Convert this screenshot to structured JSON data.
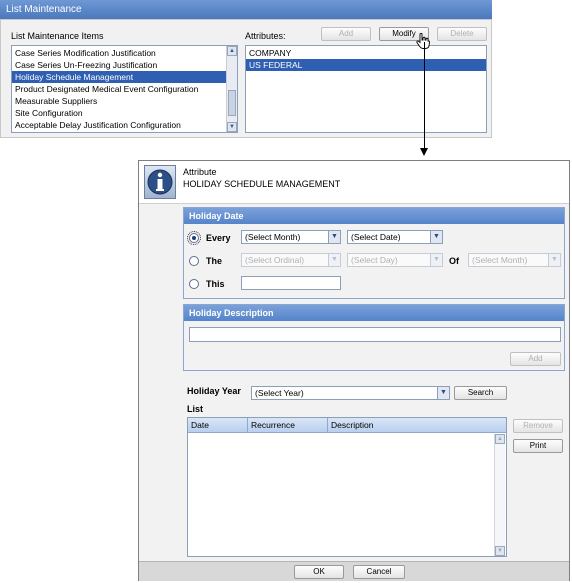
{
  "list_maintenance": {
    "title": "List Maintenance",
    "items_label": "List Maintenance Items",
    "attributes_label": "Attributes:",
    "buttons": {
      "add": "Add",
      "modify": "Modify",
      "delete": "Delete"
    },
    "items": [
      "Case Series Modification Justification",
      "Case Series Un-Freezing Justification",
      "Holiday Schedule Management",
      "Product Designated Medical Event Configuration",
      "Measurable Suppliers",
      "Site Configuration",
      "Acceptable Delay Justification Configuration"
    ],
    "selected_item_index": 2,
    "attributes": [
      "COMPANY",
      "US FEDERAL"
    ],
    "selected_attribute_index": 1
  },
  "dialog": {
    "caption": "Attribute",
    "value": "HOLIDAY SCHEDULE MANAGEMENT",
    "holiday_date": {
      "header": "Holiday Date",
      "every_label": "Every",
      "the_label": "The",
      "this_label": "This",
      "of_label": "Of",
      "selected_option": "every",
      "every_month": "(Select Month)",
      "every_date": "(Select Date)",
      "the_ordinal": "(Select Ordinal)",
      "the_day": "(Select Day)",
      "the_month": "(Select Month)",
      "this_value": ""
    },
    "holiday_description": {
      "header": "Holiday Description",
      "value": "",
      "add_label": "Add"
    },
    "holiday_year": {
      "label": "Holiday Year",
      "value": "(Select Year)",
      "search_label": "Search"
    },
    "list": {
      "label": "List",
      "columns": [
        "Date",
        "Recurrence",
        "Description"
      ],
      "rows": [],
      "remove_label": "Remove",
      "print_label": "Print"
    },
    "footer": {
      "ok_label": "OK",
      "cancel_label": "Cancel"
    }
  },
  "colors": {
    "title_bar": "#4a78bd",
    "selection": "#2f5fb3",
    "group_header": "#5584c9"
  }
}
